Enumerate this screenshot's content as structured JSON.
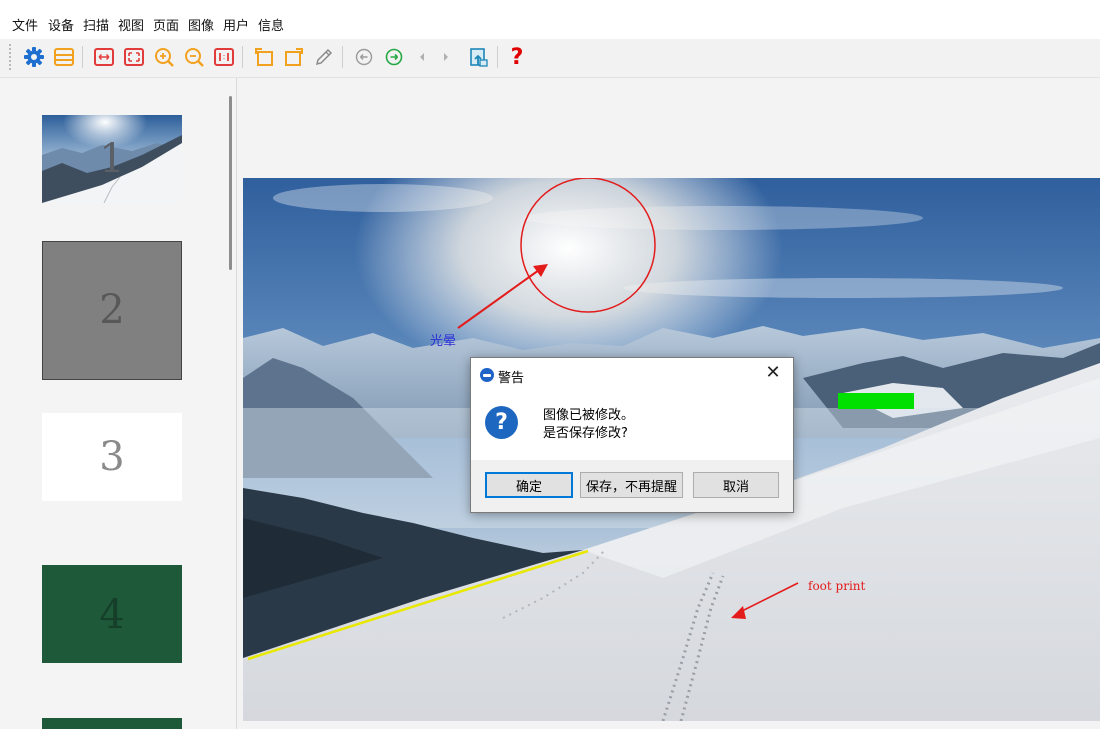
{
  "menubar": {
    "items": [
      "文件",
      "设备",
      "扫描",
      "视图",
      "页面",
      "图像",
      "用户",
      "信息"
    ]
  },
  "toolbar": {
    "icons": [
      "settings-icon",
      "layout-icon",
      "fit-width-icon",
      "fit-window-icon",
      "zoom-in-icon",
      "zoom-out-icon",
      "actual-size-icon",
      "rotate-left-icon",
      "rotate-right-icon",
      "pen-icon",
      "previous-page-icon",
      "next-page-icon",
      "arrow-left-icon",
      "arrow-right-icon",
      "export-icon",
      "help-icon"
    ],
    "help_glyph": "?"
  },
  "thumbnails": [
    {
      "label": "1",
      "kind": "photo"
    },
    {
      "label": "2",
      "kind": "gray"
    },
    {
      "label": "3",
      "kind": "white"
    },
    {
      "label": "4",
      "kind": "green"
    }
  ],
  "annotations": {
    "halo_label": "光晕",
    "footprint_label": "foot print"
  },
  "dialog": {
    "title": "警告",
    "message_line1": "图像已被修改。",
    "message_line2": "是否保存修改?",
    "ok_label": "确定",
    "save_no_remind_label": "保存，不再提醒",
    "cancel_label": "取消",
    "close_glyph": "✕",
    "question_glyph": "?"
  },
  "colors": {
    "accent_blue": "#1d67c0",
    "toolbar_orange": "#f2a11f",
    "toolbar_red": "#e23b3b",
    "help_red": "#e10000",
    "annotation_red": "#e31b1b",
    "annotation_green": "#00e000",
    "annotation_yellow": "#e8e800"
  }
}
